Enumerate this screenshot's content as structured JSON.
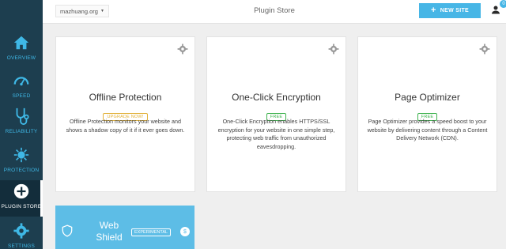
{
  "sidebar": {
    "items": [
      {
        "label": "OVERVIEW",
        "icon": "home-icon"
      },
      {
        "label": "SPEED",
        "icon": "speedometer-icon"
      },
      {
        "label": "RELIABILITY",
        "icon": "stethoscope-icon"
      },
      {
        "label": "PROTECTION",
        "icon": "virus-icon"
      },
      {
        "label": "PLUGIN STORE",
        "icon": "plus-circle-icon",
        "active": true
      },
      {
        "label": "SETTINGS",
        "icon": "gear-icon"
      }
    ]
  },
  "topbar": {
    "site_select": "mazhuang.org",
    "page_title": "Plugin Store",
    "new_site_label": "NEW SITE",
    "notification_count": "0"
  },
  "cards": [
    {
      "title": "Offline Protection",
      "badge": "UPGRADE NOW!",
      "badge_type": "upgrade",
      "description": "Offline Protection monitors your website and shows a shadow copy of it if it ever goes down."
    },
    {
      "title": "One-Click Encryption",
      "badge": "FREE",
      "badge_type": "free",
      "description": "One-Click Encryption enables HTTPS/SSL encryption for your website in one simple step, protecting web traffic from unauthorized eavesdropping."
    },
    {
      "title": "Page Optimizer",
      "badge": "FREE",
      "badge_type": "free",
      "description": "Page Optimizer provides a speed boost to your website by delivering content through a Content Delivery Network (CDN)."
    }
  ],
  "feature_card": {
    "title": "Web Shield",
    "badge": "EXPERIMENTAL",
    "price_symbol": "$"
  },
  "colors": {
    "sidebar_bg": "#1d3e4f",
    "sidebar_accent": "#3fb8e6",
    "primary_button": "#47b6e6",
    "free_badge": "#3fb34f",
    "upgrade_badge": "#e2b23a",
    "feature_card_bg": "#5dbde6"
  }
}
